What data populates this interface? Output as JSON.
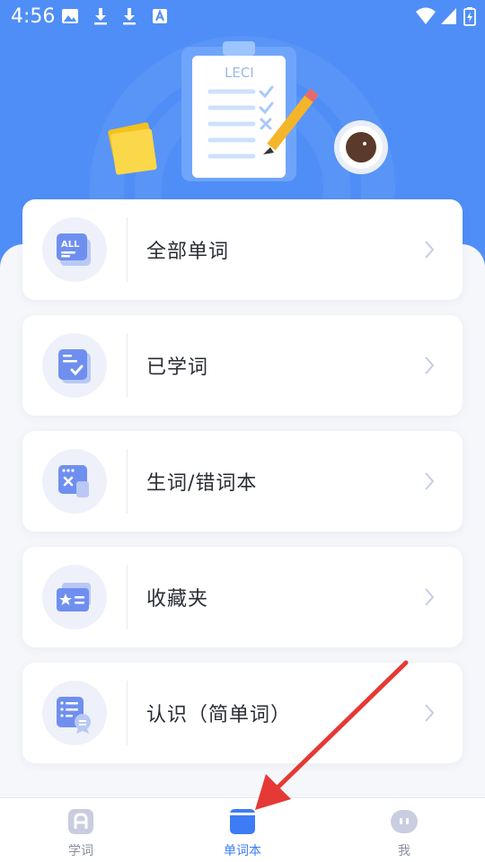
{
  "status_bar": {
    "time": "4:56",
    "left_icons": [
      "image-icon",
      "download-icon",
      "download-icon",
      "text-app-icon"
    ],
    "right_icons": [
      "wifi-icon",
      "signal-icon",
      "battery-icon"
    ]
  },
  "hero": {
    "clipboard_text": "LECI",
    "colors": {
      "background": "#4f8ef7"
    }
  },
  "menu": {
    "items": [
      {
        "label": "全部单词",
        "icon": "all-words-icon"
      },
      {
        "label": "已学词",
        "icon": "learned-words-icon"
      },
      {
        "label": "生词/错词本",
        "icon": "wrong-words-icon"
      },
      {
        "label": "收藏夹",
        "icon": "favorites-icon"
      },
      {
        "label": "认识（简单词）",
        "icon": "known-words-icon"
      }
    ]
  },
  "bottom_nav": {
    "items": [
      {
        "label": "学词",
        "icon": "learn-icon",
        "active": false
      },
      {
        "label": "单词本",
        "icon": "wordbook-icon",
        "active": true
      },
      {
        "label": "我",
        "icon": "profile-icon",
        "active": false
      }
    ],
    "colors": {
      "active": "#3e7cf4",
      "inactive": "#8a8f9c"
    }
  },
  "annotation": {
    "icon": "red-arrow-icon",
    "color": "#e53935"
  }
}
